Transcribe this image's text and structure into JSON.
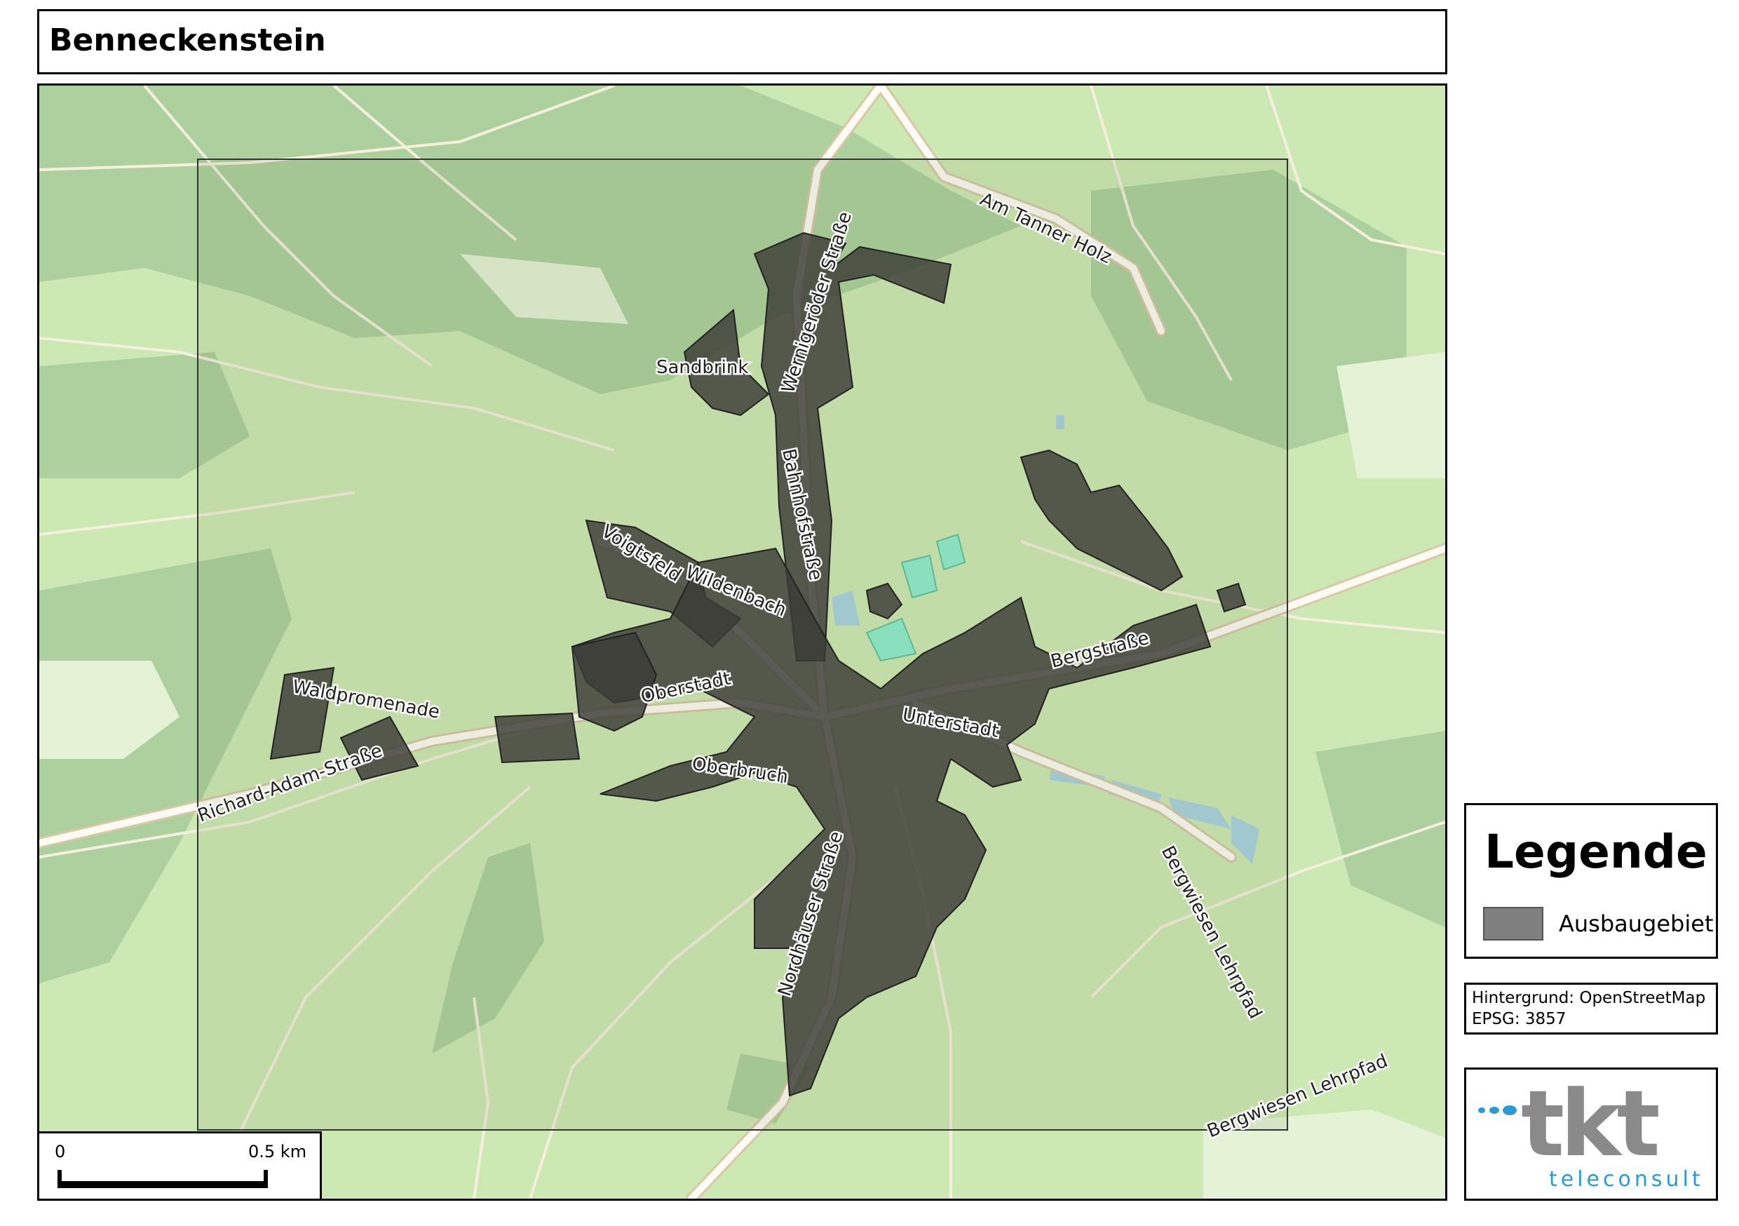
{
  "title": "Benneckenstein",
  "legend": {
    "title": "Legende",
    "items": [
      {
        "label": "Ausbaugebiet",
        "color": "#7f7f7f"
      }
    ]
  },
  "source": {
    "background": "Hintergrund: OpenStreetMap",
    "crs": "EPSG: 3857"
  },
  "scale": {
    "start_label": "0",
    "end_label": "0.5 km"
  },
  "logo": {
    "wordmark": "tkt",
    "subtitle": "teleconsult",
    "dot_color": "#2a9ad6",
    "text_color": "#8a8a8a"
  },
  "map": {
    "colors": {
      "meadow": "#cde9b3",
      "forest": "#add19e",
      "road": "#fbf7ea",
      "road_casing": "#d9c7a6",
      "area_fill": "#3a3a36",
      "water": "#aad3df"
    },
    "street_labels": [
      "Am Tanner Holz",
      "Wernigeröder Straße",
      "Sandbrink",
      "Bahnhofstraße",
      "Voigtsfeld",
      "Wildenbach",
      "Oberstadt",
      "Waldpromenade",
      "Richard-Adam-Straße",
      "Oberbruch",
      "Unterstadt",
      "Bergstraße",
      "Nordhäuser Straße",
      "Bergwiesen Lehrpfad",
      "Bergwiesen Lehrpfad"
    ]
  }
}
